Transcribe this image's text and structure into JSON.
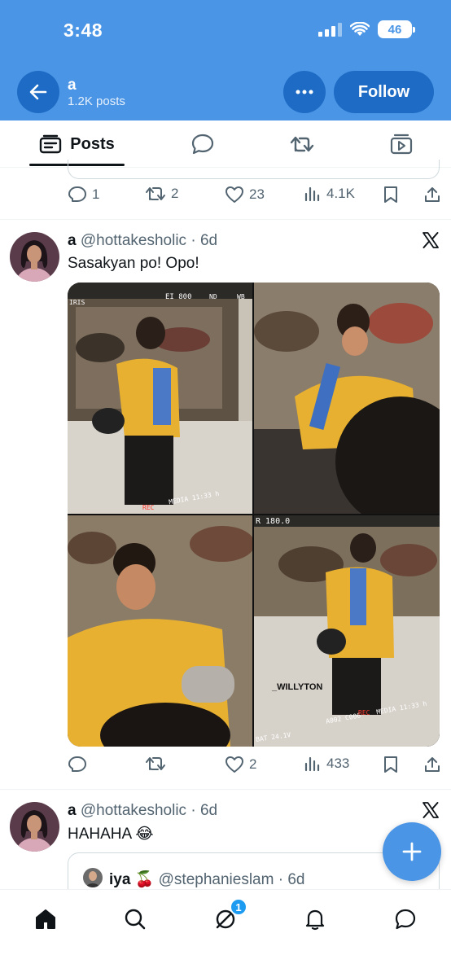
{
  "status_bar": {
    "time": "3:48",
    "battery": "46"
  },
  "profile": {
    "name": "a",
    "post_count": "1.2K posts",
    "follow_label": "Follow"
  },
  "tabs": [
    {
      "label": "Posts",
      "icon": "posts-icon",
      "active": true
    },
    {
      "label": "",
      "icon": "replies-icon"
    },
    {
      "label": "",
      "icon": "reposts-icon"
    },
    {
      "label": "",
      "icon": "media-icon"
    }
  ],
  "prev_post": {
    "replies": "1",
    "reposts": "2",
    "likes": "23",
    "views": "4.1K"
  },
  "post1": {
    "name": "a",
    "handle": "@hottakesholic",
    "time": "· 6d",
    "text": "Sasakyan po! Opo!",
    "replies": "",
    "reposts": "",
    "likes": "2",
    "views": "433",
    "photo_overlays": {
      "iris": "IRIS",
      "ei": "EI 800",
      "nd": "ND",
      "wb": "WB",
      "media_time": "MEDIA 11:33 h",
      "rec": "REC",
      "focal": "R 180.0",
      "clip": "A002  C006",
      "battery_v": "BAT 24.1V",
      "watermark": "_WILLYTON"
    }
  },
  "post2": {
    "name": "a",
    "handle": "@hottakesholic",
    "time": "· 6d",
    "text": "HAHAHA 😂",
    "quote": {
      "name": "iya 🍒",
      "handle": "@stephanieslam",
      "time": "· 6d"
    }
  },
  "nav": {
    "messages_badge": "1"
  },
  "colors": {
    "brand_blue": "#4a95e6",
    "button_blue": "#1d6bc4",
    "badge_blue": "#1d9bf0",
    "shirt_yellow": "#e8b030"
  }
}
